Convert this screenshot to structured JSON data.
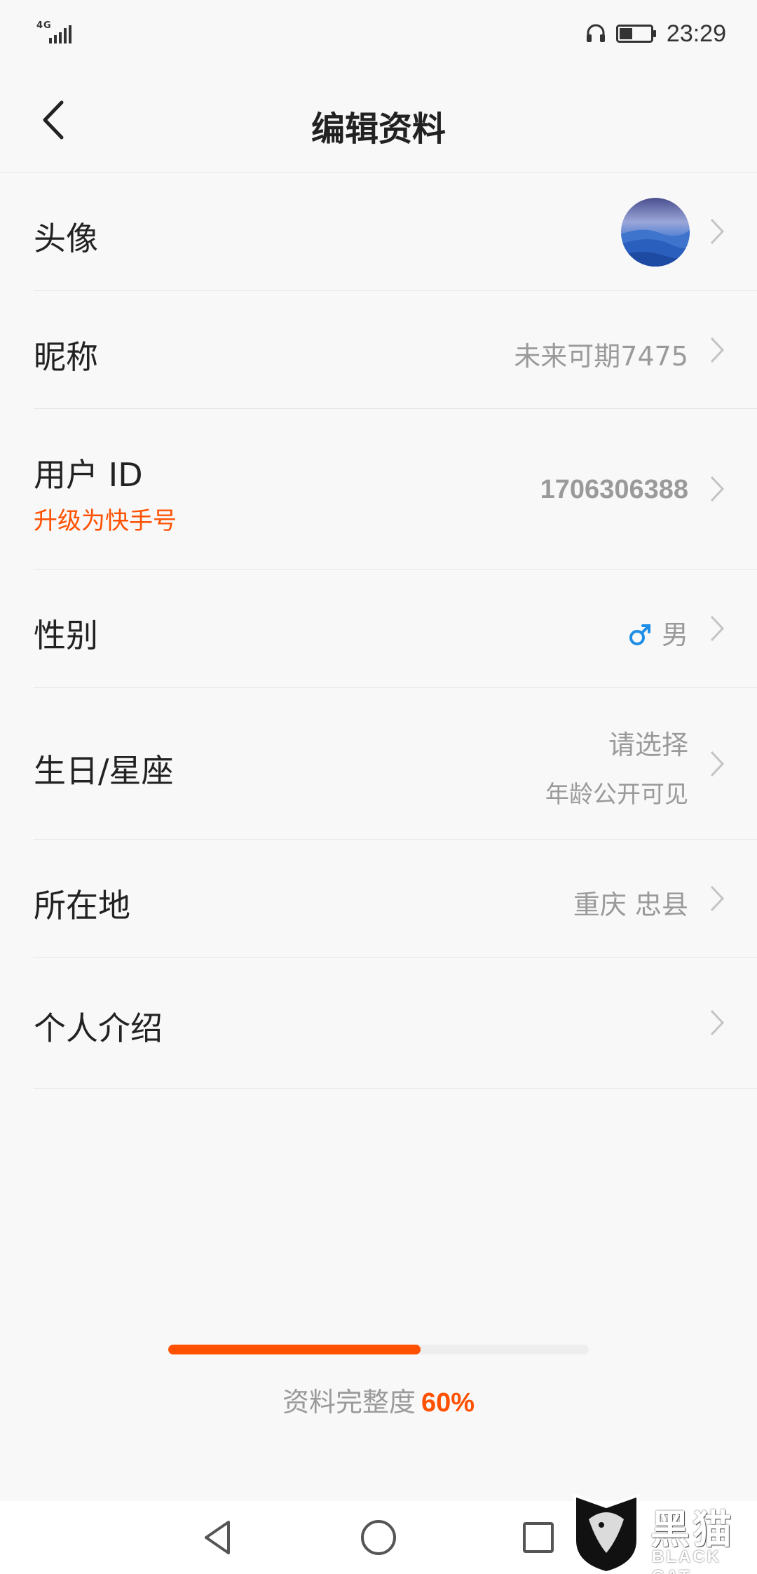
{
  "status_bar": {
    "network": "4G",
    "time": "23:29",
    "icons": [
      "signal-icon",
      "headset-icon",
      "battery-icon"
    ]
  },
  "header": {
    "title": "编辑资料",
    "back_icon": "chevron-left-icon"
  },
  "rows": {
    "avatar": {
      "label": "头像"
    },
    "nickname": {
      "label": "昵称",
      "value": "未来可期7475"
    },
    "user_id": {
      "label": "用户 ID",
      "sub_label": "升级为快手号",
      "value": "1706306388"
    },
    "gender": {
      "label": "性别",
      "value": "男",
      "icon": "male-icon"
    },
    "birthday": {
      "label": "生日/星座",
      "value": "请选择",
      "hint": "年龄公开可见"
    },
    "location": {
      "label": "所在地",
      "value": "重庆 忠县"
    },
    "bio": {
      "label": "个人介绍"
    }
  },
  "completeness": {
    "label": "资料完整度",
    "value": "60%",
    "progress_fraction": 0.6
  },
  "system_nav": {
    "buttons": [
      "back-triangle-icon",
      "home-circle-icon",
      "recents-square-icon"
    ]
  },
  "watermark": {
    "text_cn": "黑猫",
    "text_en": "BLACK CAT"
  },
  "colors": {
    "accent": "#ff5000",
    "male_blue": "#1e8ee6",
    "secondary_text": "#9a9a9a",
    "divider": "#e6e6e6",
    "background": "#f8f8f8"
  }
}
